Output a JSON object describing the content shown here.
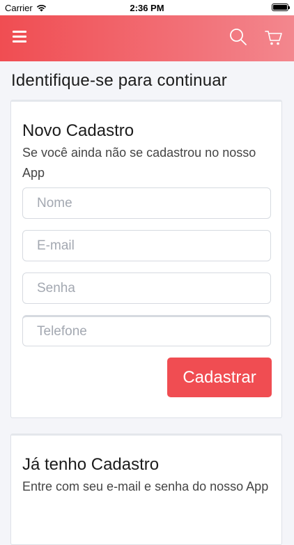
{
  "status_bar": {
    "carrier": "Carrier",
    "time": "2:36 PM"
  },
  "header": {
    "menu_icon": "hamburger-menu-icon",
    "search_icon": "search-icon",
    "cart_icon": "cart-icon",
    "gradient_start": "#f04d52",
    "gradient_end": "#f3878e"
  },
  "page": {
    "title": "Identifique-se para continuar"
  },
  "register": {
    "title": "Novo Cadastro",
    "subtitle": "Se você ainda não se cadastrou no nosso App",
    "name_placeholder": "Nome",
    "email_placeholder": "E-mail",
    "password_placeholder": "Senha",
    "phone_placeholder": "Telefone",
    "submit_label": "Cadastrar"
  },
  "login": {
    "title": "Já tenho Cadastro",
    "subtitle": "Entre com seu e-mail e senha do nosso App"
  },
  "colors": {
    "accent": "#f04d52",
    "background": "#f4f5f9"
  }
}
